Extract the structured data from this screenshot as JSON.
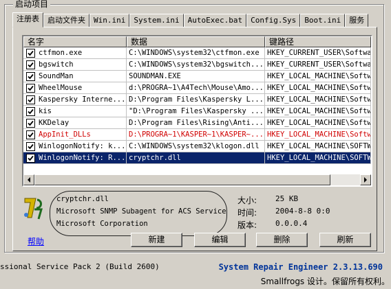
{
  "group_title": "启动项目",
  "tabs": [
    "注册表",
    "启动文件夹",
    "Win.ini",
    "System.ini",
    "AutoExec.bat",
    "Config.Sys",
    "Boot.ini",
    "服务"
  ],
  "columns": [
    "名字",
    "数据",
    "键路径"
  ],
  "rows": [
    {
      "name": "ctfmon.exe",
      "data": "C:\\WINDOWS\\system32\\ctfmon.exe",
      "path": "HKEY_CURRENT_USER\\Softwar"
    },
    {
      "name": "bgswitch",
      "data": "C:\\WINDOWS\\system32\\bgswitch...",
      "path": "HKEY_CURRENT_USER\\Softwar"
    },
    {
      "name": "SoundMan",
      "data": "SOUNDMAN.EXE",
      "path": "HKEY_LOCAL_MACHINE\\Softwa"
    },
    {
      "name": "WheelMouse",
      "data": "d:\\PROGRA~1\\A4Tech\\Mouse\\Amo...",
      "path": "HKEY_LOCAL_MACHINE\\Softwa"
    },
    {
      "name": "Kaspersky Interne...",
      "data": "D:\\Program Files\\Kaspersky L...",
      "path": "HKEY_LOCAL_MACHINE\\Softwa"
    },
    {
      "name": "kis",
      "data": "\"D:\\Program Files\\Kaspersky ...",
      "path": "HKEY_LOCAL_MACHINE\\Softwa"
    },
    {
      "name": "KKDelay",
      "data": "D:\\Program Files\\Rising\\Anti...",
      "path": "HKEY_LOCAL_MACHINE\\Softwa"
    },
    {
      "name": "AppInit_DLLs",
      "data": "D:\\PROGRA~1\\KASPER~1\\KASPER~...",
      "path": "HKEY_LOCAL_MACHINE\\Softwa"
    },
    {
      "name": "WinlogonNotify: k...",
      "data": "C:\\WINDOWS\\system32\\klogon.dll",
      "path": "HKEY_LOCAL_MACHINE\\SOFTWA"
    },
    {
      "name": "WinlogonNotify: R...",
      "data": "cryptchr.dll",
      "path": "HKEY_LOCAL_MACHINE\\SOFTWA"
    }
  ],
  "detail": {
    "file": "cryptchr.dll",
    "description": "Microsoft SNMP Subagent for ACS Service",
    "company": "Microsoft Corporation",
    "size_label": "大小:",
    "size_value": "25 KB",
    "time_label": "时间:",
    "time_value": "2004-8-8 0:0",
    "version_label": "版本:",
    "version_value": "0.0.0.4"
  },
  "help": "帮助",
  "buttons": {
    "new": "新建",
    "edit": "编辑",
    "delete": "删除",
    "refresh": "刷新"
  },
  "footer": {
    "os": "ssional Service Pack 2 (Build 2600)",
    "title": "System Repair Engineer 2.3.13.690",
    "credit": "Smallfrogs 设计。保留所有权利。"
  },
  "colors": {
    "selected": "#0a246a",
    "warning_row": "#d00000",
    "title": "#003399"
  }
}
